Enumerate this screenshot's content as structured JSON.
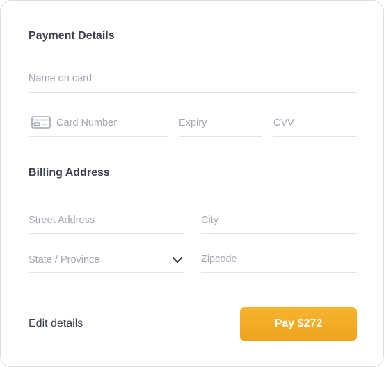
{
  "payment": {
    "title": "Payment Details",
    "name_placeholder": "Name on card",
    "card_number_placeholder": "Card Number",
    "card_icon": "credit-card-icon",
    "expiry_placeholder": "Expiry",
    "cvv_placeholder": "CVV"
  },
  "billing": {
    "title": "Billing Address",
    "street_placeholder": "Street Address",
    "city_placeholder": "City",
    "state_selected": "State / Province",
    "state_icon": "chevron-down-icon",
    "zipcode_placeholder": "Zipcode"
  },
  "actions": {
    "edit_label": "Edit details",
    "pay_label": "Pay $272"
  },
  "colors": {
    "accent": "#f5ae26",
    "text": "#3d3f4f",
    "placeholder": "#a3a6b3",
    "divider": "#e3e4ea"
  }
}
